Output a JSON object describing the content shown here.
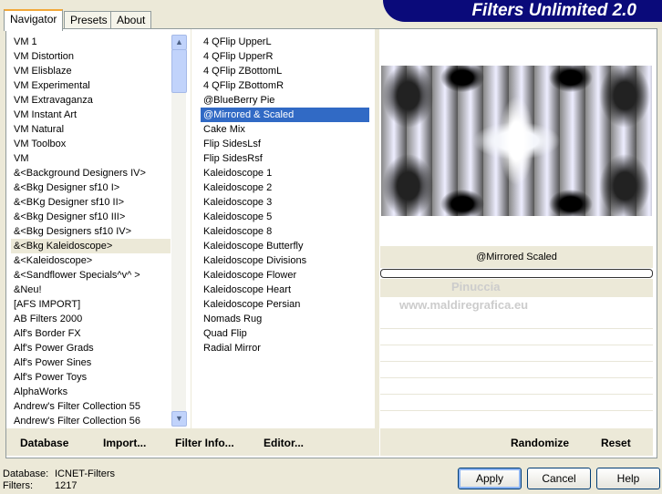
{
  "title": "Filters Unlimited 2.0",
  "tabs": [
    {
      "label": "Navigator"
    },
    {
      "label": "Presets"
    },
    {
      "label": "About"
    }
  ],
  "categories": [
    "VM 1",
    "VM Distortion",
    "VM Elisblaze",
    "VM Experimental",
    "VM Extravaganza",
    "VM Instant Art",
    "VM Natural",
    "VM Toolbox",
    "VM",
    "&<Background Designers IV>",
    "&<Bkg Designer sf10 I>",
    "&<BKg Designer sf10 II>",
    "&<Bkg Designer sf10 III>",
    "&<Bkg Designers sf10 IV>",
    "&<Bkg Kaleidoscope>",
    "&<Kaleidoscope>",
    "&<Sandflower Specials^v^ >",
    "&Neu!",
    "[AFS IMPORT]",
    "AB Filters 2000",
    "Alf's Border FX",
    "Alf's Power Grads",
    "Alf's Power Sines",
    "Alf's Power Toys",
    "AlphaWorks",
    "Andrew's Filter Collection 55",
    "Andrew's Filter Collection 56"
  ],
  "selected_category": "&<Bkg Kaleidoscope>",
  "filters": [
    "4 QFlip UpperL",
    "4 QFlip UpperR",
    "4 QFlip ZBottomL",
    "4 QFlip ZBottomR",
    "@BlueBerry Pie",
    "@Mirrored & Scaled",
    "Cake Mix",
    "Flip SidesLsf",
    "Flip SidesRsf",
    "Kaleidoscope 1",
    "Kaleidoscope 2",
    "Kaleidoscope 3",
    "Kaleidoscope 5",
    "Kaleidoscope 8",
    "Kaleidoscope Butterfly",
    "Kaleidoscope Divisions",
    "Kaleidoscope Flower",
    "Kaleidoscope Heart",
    "Kaleidoscope Persian",
    "Nomads Rug",
    "Quad Flip",
    "Radial Mirror"
  ],
  "selected_filter": "@Mirrored & Scaled",
  "preview": {
    "filter_name": "@Mirrored  Scaled",
    "watermark1": "Pinuccia",
    "watermark2": "www.maldiregrafica.eu"
  },
  "bottom": {
    "database": "Database",
    "import": "Import...",
    "filter_info": "Filter Info...",
    "editor": "Editor...",
    "randomize": "Randomize",
    "reset": "Reset"
  },
  "status": {
    "db_label": "Database:",
    "db_value": "ICNET-Filters",
    "filters_label": "Filters:",
    "filters_value": "1217"
  },
  "buttons": {
    "apply": "Apply",
    "cancel": "Cancel",
    "help": "Help"
  }
}
